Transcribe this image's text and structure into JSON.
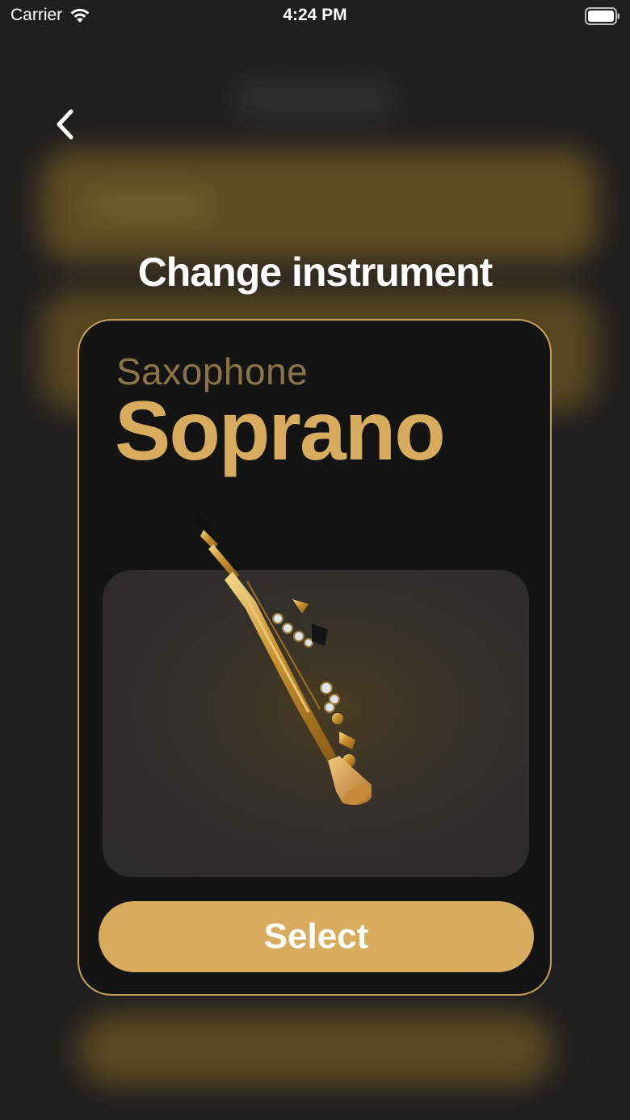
{
  "status_bar": {
    "carrier": "Carrier",
    "time": "4:24 PM"
  },
  "modal": {
    "title": "Change instrument",
    "instrument_family": "Saxophone",
    "instrument_name": "Soprano",
    "select_label": "Select"
  },
  "icons": {
    "back": "chevron-left-icon",
    "wifi": "wifi-icon",
    "battery": "battery-icon",
    "image": "saxophone-image"
  },
  "colors": {
    "accent": "#d8ac5e",
    "card_border": "#c9a25a",
    "family_text": "#8c7449",
    "card_background": "#141414",
    "screen_background": "#1f1f1f"
  }
}
